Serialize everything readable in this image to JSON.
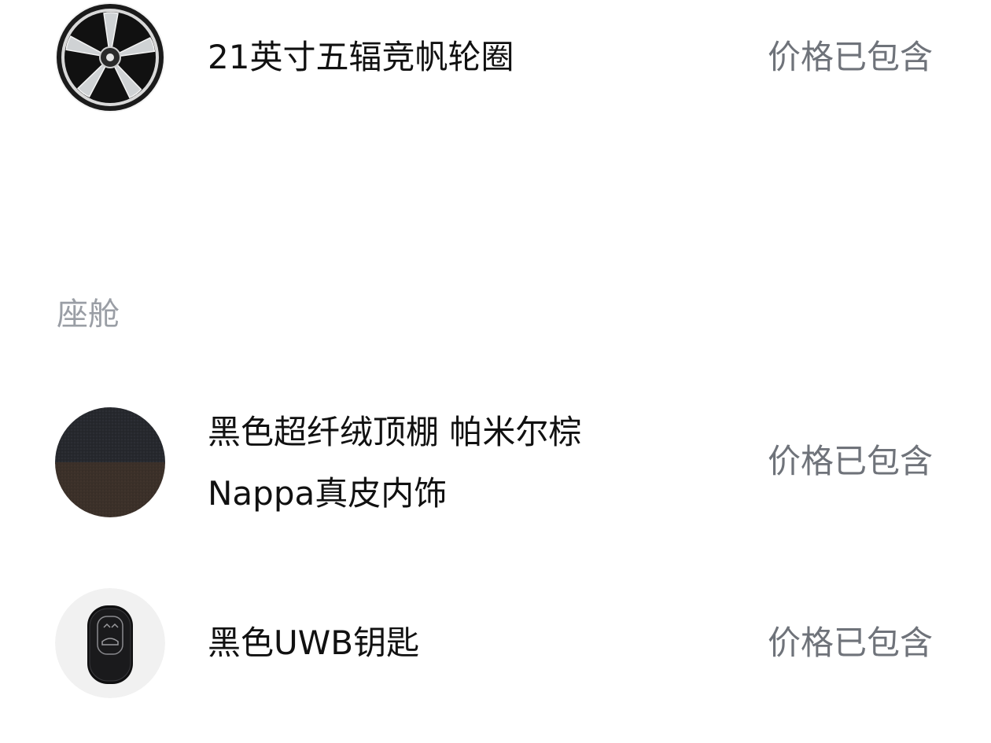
{
  "items": [
    {
      "name": "21英寸五辐竞帆轮圈",
      "status": "价格已包含",
      "icon": "wheel-rim-icon"
    },
    {
      "name_lines": [
        "黑色超纤绒顶棚 帕米尔棕",
        "Nappa真皮内饰"
      ],
      "status": "价格已包含",
      "icon": "interior-swatch-icon"
    },
    {
      "name": "黑色UWB钥匙",
      "status": "价格已包含",
      "icon": "car-key-icon"
    }
  ],
  "sections": {
    "cabin_title": "座舱"
  },
  "colors": {
    "primary_text": "#111111",
    "secondary_text": "#6f737a",
    "section_title": "#9a9ea5",
    "background": "#ffffff"
  }
}
